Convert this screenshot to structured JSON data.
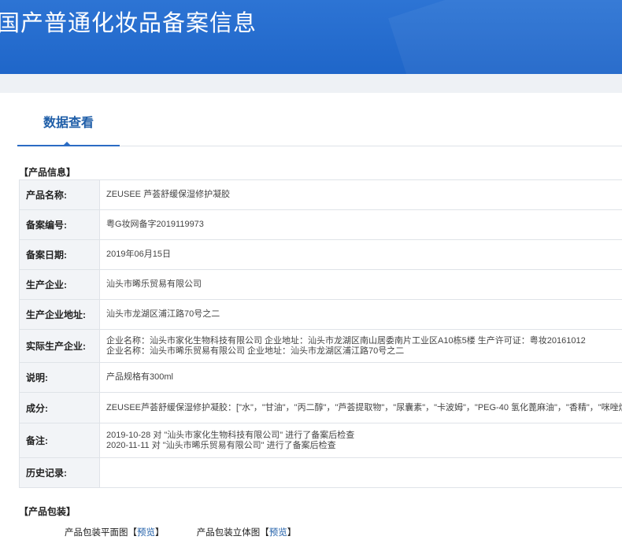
{
  "header": {
    "title": "国产普通化妆品备案信息"
  },
  "tabs": [
    {
      "label": "数据查看"
    }
  ],
  "product_info": {
    "section_title": "【产品信息】",
    "rows": [
      {
        "label": "产品名称:",
        "lines": [
          "ZEUSEE 芦荟舒缓保湿修护凝胶"
        ]
      },
      {
        "label": "备案编号:",
        "lines": [
          "粤G妆网备字2019119973"
        ]
      },
      {
        "label": "备案日期:",
        "lines": [
          "2019年06月15日"
        ]
      },
      {
        "label": "生产企业:",
        "lines": [
          "汕头市晞乐贸易有限公司"
        ]
      },
      {
        "label": "生产企业地址:",
        "lines": [
          "汕头市龙湖区浦江路70号之二"
        ]
      },
      {
        "label": "实际生产企业:",
        "lines": [
          "企业名称：汕头市家化生物科技有限公司 企业地址：汕头市龙湖区南山居委南片工业区A10栋5楼 生产许可证：粤妆20161012",
          "企业名称：汕头市晞乐贸易有限公司 企业地址：汕头市龙湖区浦江路70号之二"
        ]
      },
      {
        "label": "说明:",
        "lines": [
          "产品规格有300ml"
        ]
      },
      {
        "label": "成分:",
        "lines": [
          "ZEUSEE芦荟舒缓保湿修护凝胶：[\"水\"，\"甘油\"，\"丙二醇\"，\"芦荟提取物\"，\"尿囊素\"，\"卡波姆\"，\"PEG-40 氢化蓖麻油\"，\"香精\"，\"咪唑烷基脲\"]"
        ]
      },
      {
        "label": "备注:",
        "lines": [
          "2019-10-28 对 \"汕头市家化生物科技有限公司\" 进行了备案后检查",
          "2020-11-11 对 \"汕头市晞乐贸易有限公司\" 进行了备案后检查"
        ]
      },
      {
        "label": "历史记录:",
        "lines": []
      }
    ]
  },
  "packaging": {
    "section_title": "【产品包装】",
    "items": [
      {
        "label": "产品包装平面图",
        "bracket_open": "【",
        "link": "预览",
        "bracket_close": "】"
      },
      {
        "label": "产品包装立体图",
        "bracket_open": "【",
        "link": "预览",
        "bracket_close": "】"
      }
    ]
  },
  "colors": {
    "banner": "#2a70d1",
    "accent": "#1f5ea8",
    "label_bg": "#f2f4f7",
    "border": "#dfe3e8"
  }
}
